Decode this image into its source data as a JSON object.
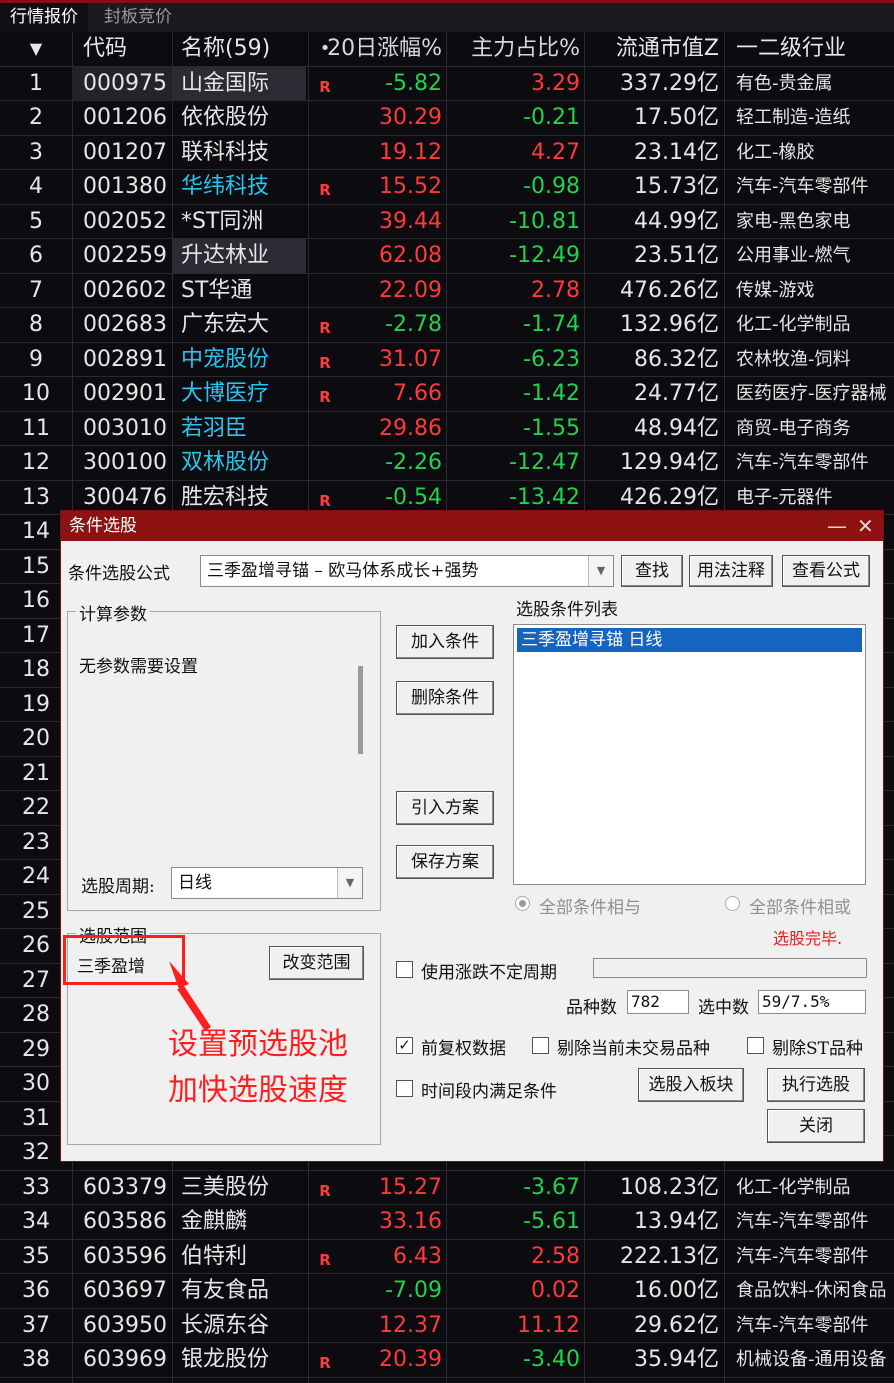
{
  "tabs": [
    "行情报价",
    "封板竞价"
  ],
  "header": {
    "sort_icon": "▼",
    "code": "代码",
    "name": "名称(59)",
    "dot": "•",
    "chg20": "20日涨幅%",
    "main_ratio": "主力占比%",
    "float_cap": "流通市值Z",
    "industry": "一二级行业"
  },
  "rows_top": [
    {
      "no": "1",
      "code": "000975",
      "name": "山金国际",
      "flag": "R",
      "chg": "-5.82",
      "main": "3.29",
      "cap": "337.29亿",
      "ind": "有色-贵金属"
    },
    {
      "no": "2",
      "code": "001206",
      "name": "依依股份",
      "flag": "",
      "chg": "30.29",
      "main": "-0.21",
      "cap": "17.50亿",
      "ind": "轻工制造-造纸"
    },
    {
      "no": "3",
      "code": "001207",
      "name": "联科科技",
      "flag": "",
      "chg": "19.12",
      "main": "4.27",
      "cap": "23.14亿",
      "ind": "化工-橡胶"
    },
    {
      "no": "4",
      "code": "001380",
      "name": "华纬科技",
      "flag": "R",
      "chg": "15.52",
      "main": "-0.98",
      "cap": "15.73亿",
      "ind": "汽车-汽车零部件"
    },
    {
      "no": "5",
      "code": "002052",
      "name": "*ST同洲",
      "flag": "",
      "chg": "39.44",
      "main": "-10.81",
      "cap": "44.99亿",
      "ind": "家电-黑色家电"
    },
    {
      "no": "6",
      "code": "002259",
      "name": "升达林业",
      "flag": "",
      "chg": "62.08",
      "main": "-12.49",
      "cap": "23.51亿",
      "ind": "公用事业-燃气"
    },
    {
      "no": "7",
      "code": "002602",
      "name": "ST华通",
      "flag": "",
      "chg": "22.09",
      "main": "2.78",
      "cap": "476.26亿",
      "ind": "传媒-游戏"
    },
    {
      "no": "8",
      "code": "002683",
      "name": "广东宏大",
      "flag": "R",
      "chg": "-2.78",
      "main": "-1.74",
      "cap": "132.96亿",
      "ind": "化工-化学制品"
    },
    {
      "no": "9",
      "code": "002891",
      "name": "中宠股份",
      "flag": "R",
      "chg": "31.07",
      "main": "-6.23",
      "cap": "86.32亿",
      "ind": "农林牧渔-饲料"
    },
    {
      "no": "10",
      "code": "002901",
      "name": "大博医疗",
      "flag": "R",
      "chg": "7.66",
      "main": "-1.42",
      "cap": "24.77亿",
      "ind": "医药医疗-医疗器械"
    },
    {
      "no": "11",
      "code": "003010",
      "name": "若羽臣",
      "flag": "",
      "chg": "29.86",
      "main": "-1.55",
      "cap": "48.94亿",
      "ind": "商贸-电子商务"
    },
    {
      "no": "12",
      "code": "300100",
      "name": "双林股份",
      "flag": "",
      "chg": "-2.26",
      "main": "-12.47",
      "cap": "129.94亿",
      "ind": "汽车-汽车零部件"
    },
    {
      "no": "13",
      "code": "300476",
      "name": "胜宏科技",
      "flag": "R",
      "chg": "-0.54",
      "main": "-13.42",
      "cap": "426.29亿",
      "ind": "电子-元器件"
    }
  ],
  "row_numbers_hidden": [
    "14",
    "15",
    "16",
    "17",
    "18",
    "19",
    "20",
    "21",
    "22",
    "23",
    "24",
    "25",
    "26",
    "27",
    "28",
    "29",
    "30",
    "31",
    "32"
  ],
  "rows_bottom": [
    {
      "no": "33",
      "code": "603379",
      "name": "三美股份",
      "flag": "R",
      "chg": "15.27",
      "main": "-3.67",
      "cap": "108.23亿",
      "ind": "化工-化学制品"
    },
    {
      "no": "34",
      "code": "603586",
      "name": "金麒麟",
      "flag": "",
      "chg": "33.16",
      "main": "-5.61",
      "cap": "13.94亿",
      "ind": "汽车-汽车零部件"
    },
    {
      "no": "35",
      "code": "603596",
      "name": "伯特利",
      "flag": "R",
      "chg": "6.43",
      "main": "2.58",
      "cap": "222.13亿",
      "ind": "汽车-汽车零部件"
    },
    {
      "no": "36",
      "code": "603697",
      "name": "有友食品",
      "flag": "",
      "chg": "-7.09",
      "main": "0.02",
      "cap": "16.00亿",
      "ind": "食品饮料-休闲食品"
    },
    {
      "no": "37",
      "code": "603950",
      "name": "长源东谷",
      "flag": "",
      "chg": "12.37",
      "main": "11.12",
      "cap": "29.62亿",
      "ind": "汽车-汽车零部件"
    },
    {
      "no": "38",
      "code": "603969",
      "name": "银龙股份",
      "flag": "R",
      "chg": "20.39",
      "main": "-3.40",
      "cap": "35.94亿",
      "ind": "机械设备-通用设备"
    }
  ],
  "cyan_names": [
    "华纬科技",
    "中宠股份",
    "大博医疗",
    "若羽臣",
    "双林股份"
  ],
  "dialog": {
    "title": "条件选股",
    "minimize": "—",
    "close": "✕",
    "formula_label": "条件选股公式",
    "formula_value": "三季盈增寻锚  –  欧马体系成长+强势",
    "find_btn": "查找",
    "usage_btn": "用法注释",
    "view_btn": "查看公式",
    "calc_params_title": "计算参数",
    "no_params": "无参数需要设置",
    "period_label": "选股周期:",
    "period_value": "日线",
    "add_btn": "加入条件",
    "delete_btn": "删除条件",
    "import_btn": "引入方案",
    "save_btn": "保存方案",
    "list_title": "选股条件列表",
    "list_item": "三季盈增寻锚  日线",
    "radio_and": "全部条件相与",
    "radio_or": "全部条件相或",
    "status": "选股完毕.",
    "scope_title": "选股范围",
    "scope_value": "三季盈增",
    "change_scope_btn": "改变范围",
    "use_variable_period": "使用涨跌不定周期",
    "count_label": "品种数",
    "count_value": "782",
    "selected_label": "选中数",
    "selected_value": "59/7.5%",
    "fq_label": "前复权数据",
    "exclude_notrade": "剔除当前未交易品种",
    "exclude_st": "剔除ST品种",
    "time_segment": "时间段内满足条件",
    "to_block_btn": "选股入板块",
    "execute_btn": "执行选股",
    "close_btn": "关闭"
  },
  "annotation": {
    "line1": "设置预选股池",
    "line2": "加快选股速度"
  },
  "colors": {
    "up": "#ff3a3a",
    "down": "#22d24d",
    "cyan": "#26c6f0",
    "title_bar": "#8e1212",
    "annotation": "#ff1e1e"
  }
}
